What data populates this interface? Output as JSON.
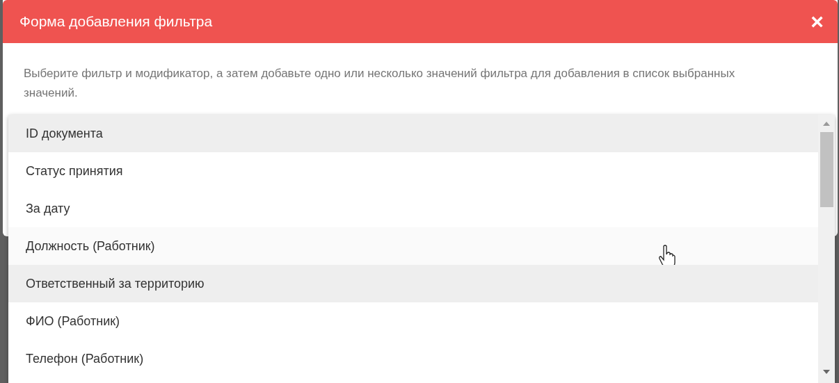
{
  "dialog": {
    "title": "Форма добавления фильтра",
    "close": "×",
    "description": "Выберите фильтр и модификатор, а затем добавьте одно или несколько значений фильтра для добавления в список выбранных значений."
  },
  "dropdown": {
    "items": [
      {
        "label": "ID документа",
        "selected": true,
        "hovered": false
      },
      {
        "label": "Статус принятия",
        "selected": false,
        "hovered": false
      },
      {
        "label": "За дату",
        "selected": false,
        "hovered": false
      },
      {
        "label": "Должность (Работник)",
        "selected": false,
        "hovered": true
      },
      {
        "label": "Ответственный за территорию",
        "selected": true,
        "hovered": false
      },
      {
        "label": "ФИО (Работник)",
        "selected": false,
        "hovered": false
      },
      {
        "label": "Телефон (Работник)",
        "selected": false,
        "hovered": false
      }
    ]
  }
}
